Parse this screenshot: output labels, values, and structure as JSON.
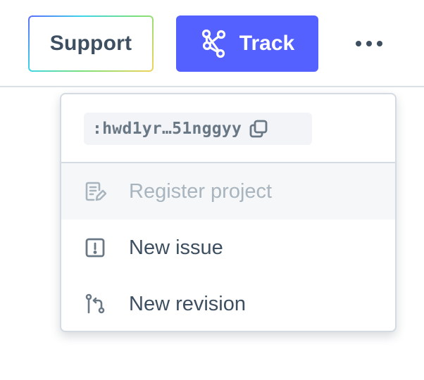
{
  "header": {
    "support_label": "Support",
    "track_label": "Track"
  },
  "dropdown": {
    "id_text": ":hwd1yr…51nggyy",
    "items": [
      {
        "label": "Register project",
        "icon": "edit-document-icon",
        "disabled": true
      },
      {
        "label": "New issue",
        "icon": "issue-alert-icon",
        "disabled": false
      },
      {
        "label": "New revision",
        "icon": "git-revision-icon",
        "disabled": false
      }
    ]
  },
  "colors": {
    "accent": "#5561ff",
    "text": "#3d4f60",
    "muted_text": "#a8b4be",
    "border": "#d4dbe2",
    "chip_bg": "#f2f4f7"
  }
}
